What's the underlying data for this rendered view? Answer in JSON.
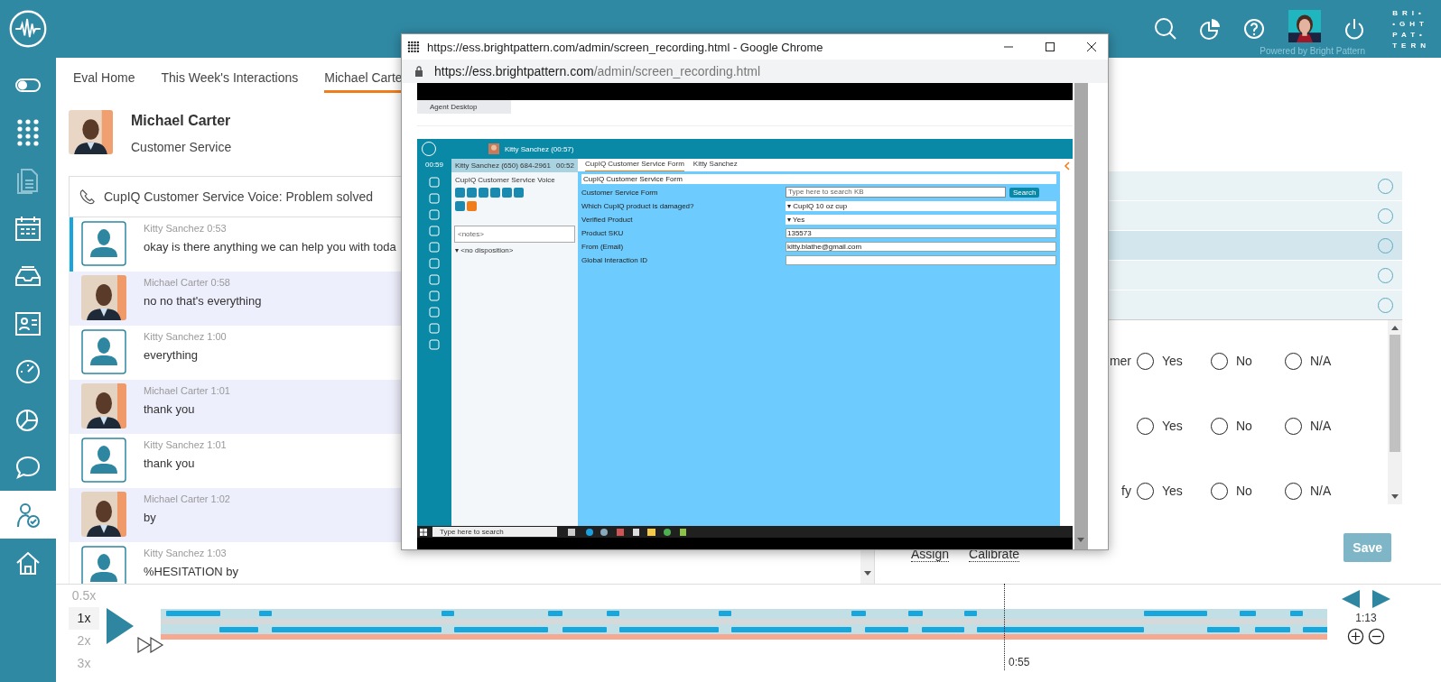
{
  "header": {
    "powered_by": "Powered by Bright Pattern",
    "logo_lines": [
      "BRI•",
      "•GHT",
      "PAT•",
      "TERN"
    ]
  },
  "sidebar": {
    "items": [
      {
        "selected": false,
        "disabled": false
      },
      {
        "selected": false,
        "disabled": false
      },
      {
        "selected": false,
        "disabled": true
      },
      {
        "selected": false,
        "disabled": false
      },
      {
        "selected": false,
        "disabled": false
      },
      {
        "selected": false,
        "disabled": false
      },
      {
        "selected": false,
        "disabled": false
      },
      {
        "selected": false,
        "disabled": false
      },
      {
        "selected": false,
        "disabled": false
      },
      {
        "selected": true,
        "disabled": false
      },
      {
        "selected": false,
        "disabled": false
      }
    ]
  },
  "tabs": [
    {
      "label": "Eval Home",
      "selected": false
    },
    {
      "label": "This Week's Interactions",
      "selected": false
    },
    {
      "label": "Michael Carte",
      "selected": true
    }
  ],
  "profile": {
    "name": "Michael Carter",
    "team": "Customer Service"
  },
  "interaction": {
    "title": "CupIQ Customer Service Voice: Problem solved"
  },
  "messages": [
    {
      "speaker": "Kitty Sanchez",
      "time": "0:53",
      "text": "okay is there anything we can help you with toda",
      "kind": "agent",
      "selected": true
    },
    {
      "speaker": "Michael Carter",
      "time": "0:58",
      "text": "no no that's everything",
      "kind": "customer",
      "selected": false
    },
    {
      "speaker": "Kitty Sanchez",
      "time": "1:00",
      "text": "everything",
      "kind": "agent",
      "selected": false
    },
    {
      "speaker": "Michael Carter",
      "time": "1:01",
      "text": "thank you",
      "kind": "customer",
      "selected": false
    },
    {
      "speaker": "Kitty Sanchez",
      "time": "1:01",
      "text": "thank you",
      "kind": "agent",
      "selected": false
    },
    {
      "speaker": "Michael Carter",
      "time": "1:02",
      "text": "by",
      "kind": "customer",
      "selected": false
    },
    {
      "speaker": "Kitty Sanchez",
      "time": "1:03",
      "text": "%HESITATION by",
      "kind": "agent",
      "selected": false
    }
  ],
  "score_rows": [
    {
      "selected": false,
      "checked": false
    },
    {
      "selected": false,
      "checked": false
    },
    {
      "selected": true,
      "checked": false
    },
    {
      "selected": false,
      "checked": false
    },
    {
      "selected": false,
      "checked": false
    }
  ],
  "questions": [
    {
      "label": "mer",
      "options": [
        {
          "label": "Yes",
          "checked": false
        },
        {
          "label": "No",
          "checked": false
        },
        {
          "label": "N/A",
          "checked": false
        }
      ]
    },
    {
      "options": [
        {
          "label": "Yes",
          "checked": false
        },
        {
          "label": "No",
          "checked": false
        },
        {
          "label": "N/A",
          "checked": false
        }
      ]
    },
    {
      "label": "fy",
      "options": [
        {
          "label": "Yes",
          "checked": false
        },
        {
          "label": "No",
          "checked": false
        },
        {
          "label": "N/A",
          "checked": false
        }
      ]
    }
  ],
  "actions": {
    "links": [
      "Assign",
      "Calibrate"
    ],
    "save": "Save"
  },
  "player": {
    "speeds": [
      {
        "label": "0.5x",
        "selected": false
      },
      {
        "label": "1x",
        "selected": true
      },
      {
        "label": "2x",
        "selected": false
      },
      {
        "label": "3x",
        "selected": false
      }
    ],
    "playhead": {
      "level": 0.723,
      "time": "0:55"
    },
    "duration": "1:13"
  },
  "popup": {
    "title": "https://ess.brightpattern.com/admin/screen_recording.html - Google Chrome",
    "address_host": "https://ess.brightpattern.com",
    "address_path": "/admin/screen_recording.html",
    "recording": {
      "browser_tab": "Agent Desktop",
      "agent": "Kitty Sanchez",
      "agent_timer": "(00:57)",
      "clock": "00:59",
      "call": {
        "caller": "Kitty Sanchez (650) 684-2961",
        "timer": "00:52",
        "service": "CupIQ Customer Service Voice",
        "notes_placeholder": "<notes>",
        "disposition": "▾ <no disposition>"
      },
      "tabs": [
        {
          "label": "CupIQ Customer Service Form",
          "selected": true
        },
        {
          "label": "Kitty Sanchez",
          "selected": false
        }
      ],
      "form": {
        "title": "CupIQ Customer Service Form",
        "search_label": "Customer Service Form",
        "search_placeholder": "Type here to search KB",
        "search_button": "Search",
        "fields": [
          {
            "label": "Which CupIQ product is damaged?",
            "value": "▾ CupIQ 10 oz cup",
            "kind": "select"
          },
          {
            "label": "Verified Product",
            "value": "▾ Yes",
            "kind": "select"
          },
          {
            "label": "Product SKU",
            "value": "135573",
            "kind": "text"
          },
          {
            "label": "From (Email)",
            "value": "kitty.blathe@gmail.com",
            "kind": "text"
          },
          {
            "label": "Global Interaction ID",
            "kind": "text"
          }
        ]
      },
      "taskbar_search": "Type here to search"
    }
  }
}
